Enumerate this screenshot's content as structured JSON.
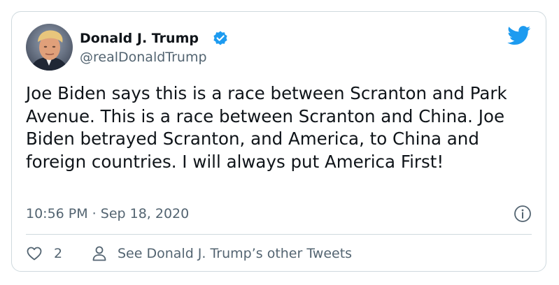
{
  "author": {
    "name": "Donald J. Trump",
    "handle": "@realDonaldTrump",
    "verified": true
  },
  "tweet": {
    "text": "Joe Biden says this is a race between Scranton and Park Avenue. This is a race between Scranton and China. Joe Biden betrayed Scranton, and America, to China and foreign countries. I will always put America First!",
    "timestamp": "10:56 PM · Sep 18, 2020"
  },
  "actions": {
    "like_count": "2",
    "other_tweets_label": "See Donald J. Trump’s other Tweets"
  },
  "icons": {
    "brand": "twitter-bird-icon",
    "verified": "verified-badge-icon",
    "info": "info-icon",
    "like": "heart-icon",
    "profile": "person-icon"
  },
  "colors": {
    "brand": "#1d9bf0",
    "text_primary": "#0f1419",
    "text_secondary": "#536471",
    "border": "#cfd9de"
  }
}
